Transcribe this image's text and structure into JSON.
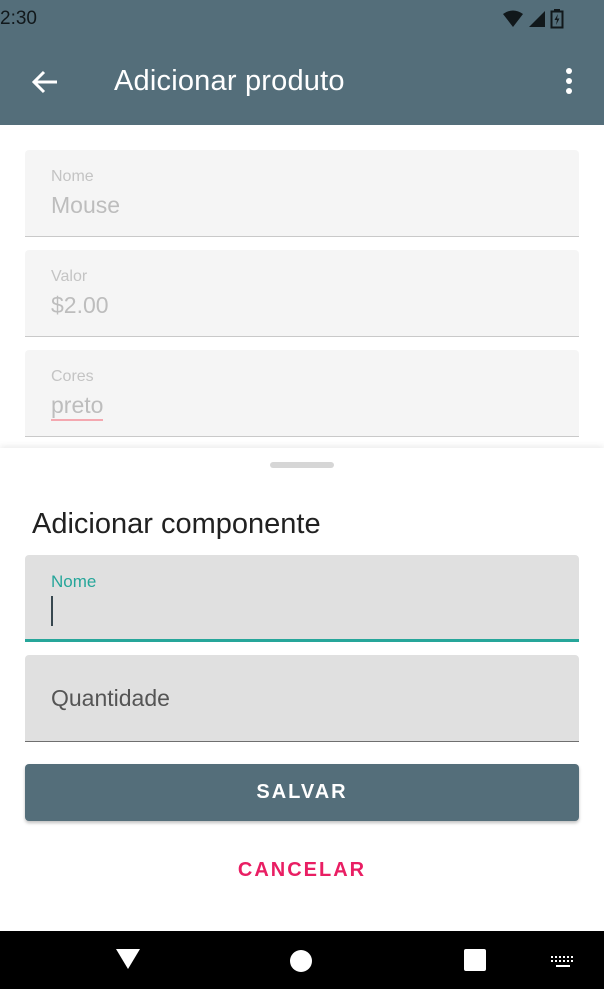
{
  "status_bar": {
    "time": "2:30"
  },
  "app_bar": {
    "title": "Adicionar produto",
    "back_icon": "arrow-back-icon",
    "more_icon": "more-vert-icon"
  },
  "product_form": {
    "fields": [
      {
        "label": "Nome",
        "value": "Mouse"
      },
      {
        "label": "Valor",
        "value": "$2.00"
      },
      {
        "label": "Cores",
        "value": "preto"
      }
    ]
  },
  "sheet": {
    "title": "Adicionar componente",
    "name_field": {
      "label": "Nome",
      "value": ""
    },
    "quantity_field": {
      "placeholder": "Quantidade"
    },
    "save_label": "SALVAR",
    "cancel_label": "CANCELAR"
  },
  "colors": {
    "primary": "#546e7a",
    "accent": "#26a69a",
    "cancel": "#e91e63"
  },
  "nav_bar": {
    "icons": [
      "back-triangle-icon",
      "home-circle-icon",
      "recents-square-icon",
      "keyboard-icon"
    ]
  }
}
